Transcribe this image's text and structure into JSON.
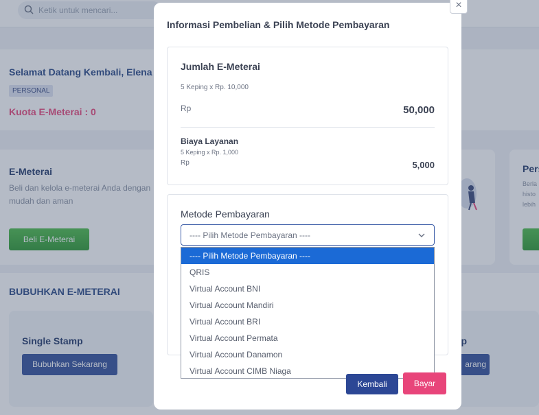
{
  "search": {
    "placeholder": "Ketik untuk mencari..."
  },
  "welcome": {
    "title": "Selamat Datang Kembali, Elena A",
    "badge": "PERSONAL",
    "quota": "Kuota E-Meterai : 0"
  },
  "emeterai_card": {
    "title": "E-Meterai",
    "description": "Beli dan kelola e-meterai Anda dengan mudah dan aman",
    "button": "Beli E-Meterai"
  },
  "personal_card": {
    "title": "Pers",
    "description": "Berla histo lebih"
  },
  "bubuhkan": {
    "section_title": "BUBUHKAN E-METERAI",
    "single_stamp": {
      "title": "Single Stamp",
      "button": "Bubuhkan Sekarang"
    },
    "other_stamp": {
      "title": "np",
      "button": "arang"
    }
  },
  "modal": {
    "close_label": "×",
    "title": "Informasi Pembelian & Pilih Metode Pembayaran",
    "jumlah": {
      "title": "Jumlah E-Meterai",
      "detail": "5 Keping x Rp. 10,000",
      "currency": "Rp",
      "amount": "50,000"
    },
    "biaya": {
      "title": "Biaya Layanan",
      "detail": "5 Keping x Rp. 1,000",
      "currency": "Rp",
      "amount": "5,000"
    },
    "payment": {
      "title": "Metode Pembayaran",
      "selected": "---- Pilih Metode Pembayaran ----",
      "options": [
        "---- Pilih Metode Pembayaran ----",
        "QRIS",
        "Virtual Account BNI",
        "Virtual Account Mandiri",
        "Virtual Account BRI",
        "Virtual Account Permata",
        "Virtual Account Danamon",
        "Virtual Account CIMB Niaga"
      ]
    },
    "back_button": "Kembali",
    "pay_button": "Bayar"
  },
  "colors": {
    "primary": "#2c4795",
    "accent_pink": "#e8457a",
    "green": "#3aa83b",
    "selected_option": "#1b6ad6"
  }
}
